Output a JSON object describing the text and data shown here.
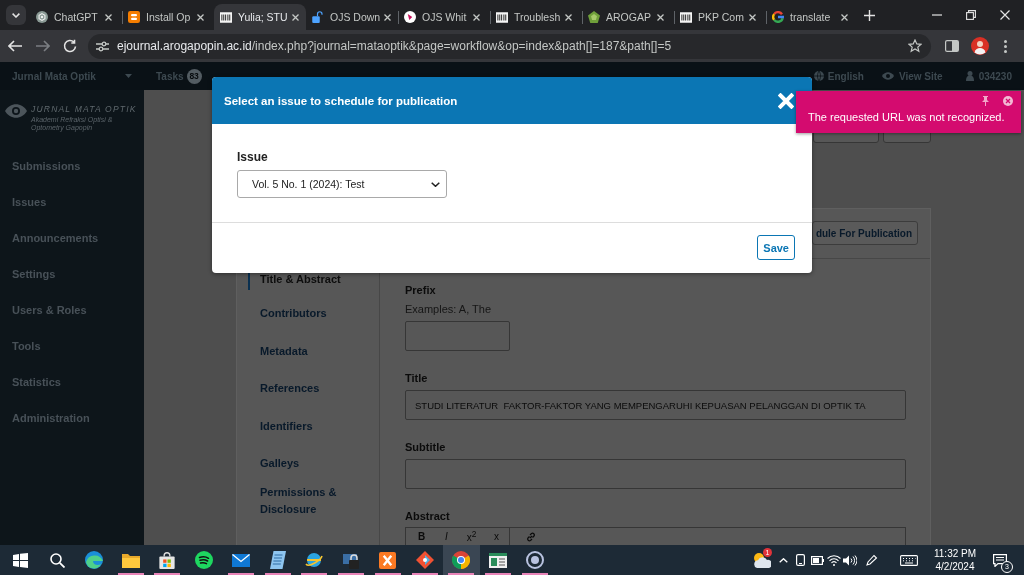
{
  "browser": {
    "tabs": [
      {
        "title": "ChatGPT",
        "selected": false
      },
      {
        "title": "Install Op",
        "selected": false
      },
      {
        "title": "Yulia; STU",
        "selected": true
      },
      {
        "title": "OJS Down",
        "selected": false
      },
      {
        "title": "OJS Whit",
        "selected": false
      },
      {
        "title": "Troublesh",
        "selected": false
      },
      {
        "title": "AROGAP",
        "selected": false
      },
      {
        "title": "PKP Com",
        "selected": false
      },
      {
        "title": "translate",
        "selected": false
      }
    ],
    "address": {
      "host": "ejournal.arogapopin.ac.id",
      "path": "/index.php?journal=mataoptik&page=workflow&op=index&path[]=187&path[]=5"
    }
  },
  "header": {
    "journal": "Jurnal Mata Optik",
    "tasks": "Tasks",
    "tasks_count": "83",
    "language": "English",
    "view_site": "View Site",
    "user": "034230"
  },
  "logo": {
    "title": "JURNAL MATA OPTIK",
    "tagline": "Akademi Refraksi Optisi & Optometry Gapopin"
  },
  "sidebar": {
    "items": [
      {
        "label": "Submissions"
      },
      {
        "label": "Issues"
      },
      {
        "label": "Announcements"
      },
      {
        "label": "Settings"
      },
      {
        "label": "Users & Roles"
      },
      {
        "label": "Tools"
      },
      {
        "label": "Statistics"
      },
      {
        "label": "Administration"
      }
    ]
  },
  "workflow": {
    "schedule_button": "dule For Publication",
    "tabs": [
      {
        "label": "Title & Abstract",
        "selected": true
      },
      {
        "label": "Contributors",
        "selected": false
      },
      {
        "label": "Metadata",
        "selected": false
      },
      {
        "label": "References",
        "selected": false
      },
      {
        "label": "Identifiers",
        "selected": false
      },
      {
        "label": "Galleys",
        "selected": false
      },
      {
        "label": "Permissions & Disclosure",
        "selected": false
      }
    ],
    "prefix": {
      "label": "Prefix",
      "help": "Examples: A, The"
    },
    "title": {
      "label": "Title",
      "value": "STUDI LITERATUR  FAKTOR-FAKTOR YANG MEMPENGARUHI KEPUASAN PELANGGAN DI OPTIK TA"
    },
    "subtitle": {
      "label": "Subtitle"
    },
    "abstract": {
      "label": "Abstract",
      "toolbar": [
        "B",
        "I",
        "x$^{2}$",
        "x"
      ]
    }
  },
  "modal": {
    "title": "Select an issue to schedule for publication",
    "field_label": "Issue",
    "value": "Vol. 5 No. 1 (2024): Test",
    "save": "Save"
  },
  "notification": {
    "message": "The requested URL was not recognized."
  },
  "taskbar": {
    "apps": [
      {
        "open": false,
        "selected": false
      },
      {
        "open": true,
        "selected": false
      },
      {
        "open": true,
        "selected": false
      },
      {
        "open": false,
        "selected": false
      },
      {
        "open": true,
        "selected": false
      },
      {
        "open": true,
        "selected": false
      },
      {
        "open": true,
        "selected": false
      },
      {
        "open": true,
        "selected": false
      },
      {
        "open": true,
        "selected": false
      },
      {
        "open": true,
        "selected": false
      },
      {
        "open": true,
        "selected": true
      },
      {
        "open": true,
        "selected": false
      },
      {
        "open": true,
        "selected": false
      }
    ],
    "weather_badge": "1",
    "time": "11:32 PM",
    "date": "4/2/2024",
    "notifications": "3"
  }
}
